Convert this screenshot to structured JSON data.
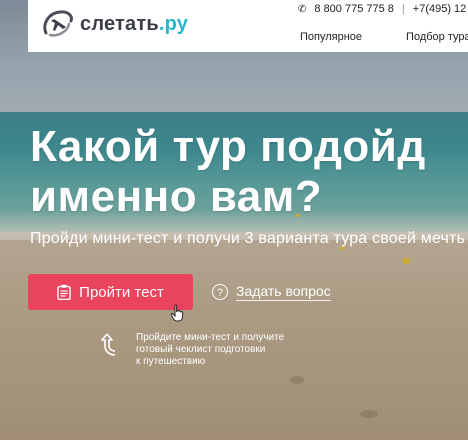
{
  "header": {
    "logo_text": "слетать",
    "logo_suffix": ".ру",
    "phone_primary": "8 800 775 775 8",
    "phone_separator": "|",
    "phone_secondary": "+7(495) 12",
    "nav": [
      "Популярное",
      "Подбор тура"
    ]
  },
  "hero": {
    "headline_line1": "Какой тур подойд",
    "headline_line2": "именно вам?",
    "subheading": "Пройди мини-тест и получи 3 варианта тура своей мечть",
    "cta_label": "Пройти тест",
    "ask_label": "Задать вопрос",
    "hint_lines": [
      "Пройдите мини-тест и получите",
      "готовый чеклист подготовки",
      "к путешествию"
    ]
  },
  "icons": {
    "logo": "plane-swirl-icon",
    "phone": "phone-icon",
    "cta": "clipboard-icon",
    "ask": "question-circle-icon",
    "hint": "curved-arrow-up-icon",
    "cursor": "hand-pointer-icon"
  },
  "colors": {
    "accent": "#e9435d",
    "brand_teal": "#2bb5c9",
    "header_bg": "#ffffff"
  }
}
